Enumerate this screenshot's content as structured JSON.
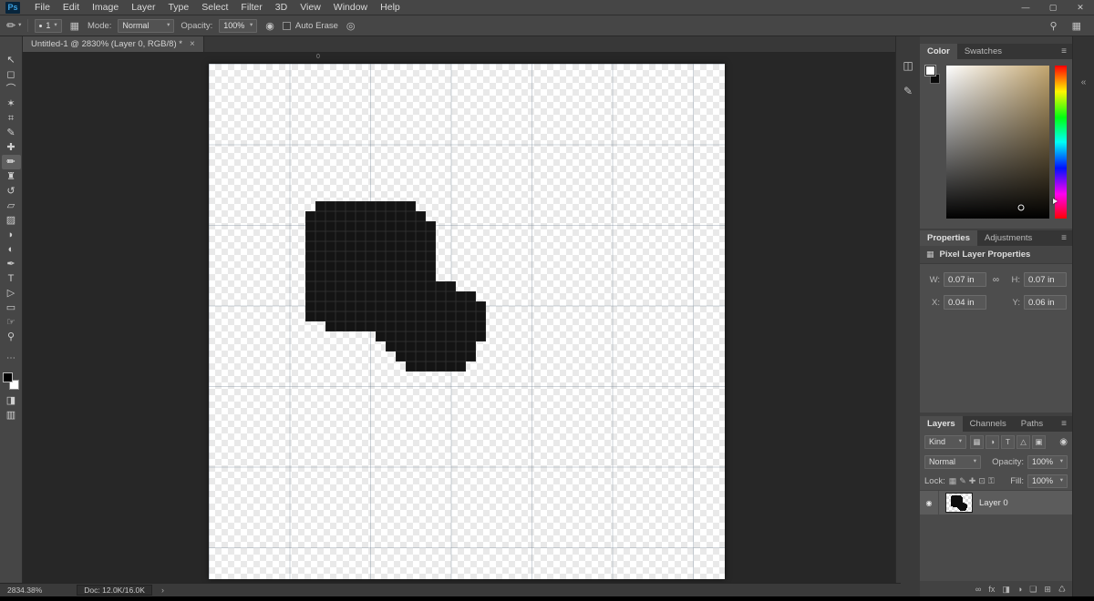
{
  "app": {
    "logo": "Ps"
  },
  "ui": {
    "caret": "▾"
  },
  "menu": {
    "items": [
      "File",
      "Edit",
      "Image",
      "Layer",
      "Type",
      "Select",
      "Filter",
      "3D",
      "View",
      "Window",
      "Help"
    ]
  },
  "window_controls": {
    "minimize": "—",
    "maximize": "▢",
    "close": "✕"
  },
  "options_bar": {
    "tool_preview_glyph": "✏",
    "brush_size": "1",
    "brush_panel_toggle_glyph": "▦",
    "mode_label": "Mode:",
    "mode_value": "Normal",
    "opacity_label": "Opacity:",
    "opacity_value": "100%",
    "pressure_glyph": "◉",
    "auto_erase_label": "Auto Erase",
    "smoothing_glyph": "◎",
    "search_glyph": "⚲",
    "workspace_glyph": "▦"
  },
  "document_tab": {
    "title": "Untitled-1 @ 2830% (Layer 0, RGB/8) *",
    "close_glyph": "×"
  },
  "tools": [
    {
      "name": "move",
      "glyph": "↖"
    },
    {
      "name": "rectangular-marquee",
      "glyph": "◻"
    },
    {
      "name": "lasso",
      "glyph": "⌒"
    },
    {
      "name": "quick-selection",
      "glyph": "✶"
    },
    {
      "name": "crop",
      "glyph": "⌗"
    },
    {
      "name": "eyedropper",
      "glyph": "✎"
    },
    {
      "name": "spot-healing-brush",
      "glyph": "✚"
    },
    {
      "name": "pencil",
      "glyph": "✏",
      "selected": true
    },
    {
      "name": "clone-stamp",
      "glyph": "♜"
    },
    {
      "name": "history-brush",
      "glyph": "↺"
    },
    {
      "name": "eraser",
      "glyph": "▱"
    },
    {
      "name": "gradient",
      "glyph": "▨"
    },
    {
      "name": "blur",
      "glyph": "◗"
    },
    {
      "name": "dodge",
      "glyph": "◐"
    },
    {
      "name": "pen",
      "glyph": "✒"
    },
    {
      "name": "type",
      "glyph": "T"
    },
    {
      "name": "path-selection",
      "glyph": "▷"
    },
    {
      "name": "rectangle",
      "glyph": "▭"
    },
    {
      "name": "hand",
      "glyph": "☞"
    },
    {
      "name": "zoom",
      "glyph": "⚲"
    }
  ],
  "tools_extra": {
    "more_glyph": "⋯",
    "mask_glyph": "◨",
    "screen_glyph": "▥"
  },
  "icon_strip": [
    {
      "name": "collapsed-panel-top",
      "glyph": "◫"
    },
    {
      "name": "collapsed-panel-bottom",
      "glyph": "✎"
    }
  ],
  "dock_edge": {
    "collapse_glyph": "«"
  },
  "color_panel": {
    "tabs": [
      "Color",
      "Swatches"
    ],
    "menu_glyph": "≡"
  },
  "properties_panel": {
    "tabs": [
      "Properties",
      "Adjustments"
    ],
    "menu_glyph": "≡",
    "header_icon": "▦",
    "title": "Pixel Layer Properties",
    "link_glyph": "∞",
    "fields": {
      "w_label": "W:",
      "w_value": "0.07 in",
      "h_label": "H:",
      "h_value": "0.07 in",
      "x_label": "X:",
      "x_value": "0.04 in",
      "y_label": "Y:",
      "y_value": "0.06 in"
    }
  },
  "layers_panel": {
    "tabs": [
      "Layers",
      "Channels",
      "Paths"
    ],
    "menu_glyph": "≡",
    "kind_label": "Kind",
    "filter_icons": [
      {
        "name": "filter-pixel-layers",
        "glyph": "▦"
      },
      {
        "name": "filter-adjustment-layers",
        "glyph": "◑"
      },
      {
        "name": "filter-type-layers",
        "glyph": "T"
      },
      {
        "name": "filter-shape-layers",
        "glyph": "△"
      },
      {
        "name": "filter-smart-objects",
        "glyph": "▣"
      }
    ],
    "filter_toggle_glyph": "◉",
    "blend_mode": "Normal",
    "opacity_label": "Opacity:",
    "opacity_value": "100%",
    "lock_label": "Lock:",
    "lock_icons": [
      {
        "name": "lock-transparency",
        "glyph": "▦"
      },
      {
        "name": "lock-paint",
        "glyph": "✎"
      },
      {
        "name": "lock-position",
        "glyph": "✚"
      },
      {
        "name": "lock-artboard",
        "glyph": "⊡"
      },
      {
        "name": "lock-all",
        "glyph": "⚿"
      }
    ],
    "fill_label": "Fill:",
    "fill_value": "100%",
    "eye_glyph": "◉",
    "rows": [
      {
        "name": "Layer 0",
        "visible": true
      }
    ],
    "bottom_icons": [
      {
        "name": "link-layers",
        "glyph": "∞"
      },
      {
        "name": "layer-effects",
        "glyph": "fx"
      },
      {
        "name": "add-layer-mask",
        "glyph": "◨"
      },
      {
        "name": "new-adjustment-layer",
        "glyph": "◑"
      },
      {
        "name": "new-group",
        "glyph": "❏"
      },
      {
        "name": "new-layer",
        "glyph": "⊞"
      },
      {
        "name": "delete-layer",
        "glyph": "♺"
      }
    ]
  },
  "status_bar": {
    "zoom": "2834.38%",
    "doc": "Doc: 12.0K/16.0K",
    "chevron": "›"
  },
  "canvas": {
    "ruler_label": "0",
    "pixel_size": 11,
    "blob_rows": [
      ".XXXXXXXXXX.......",
      "XXXXXXXXXXXX......",
      "XXXXXXXXXXXXX.....",
      "XXXXXXXXXXXXX.....",
      "XXXXXXXXXXXXX.....",
      "XXXXXXXXXXXXX.....",
      "XXXXXXXXXXXXX.....",
      "XXXXXXXXXXXXX.....",
      "XXXXXXXXXXXXXXX...",
      "XXXXXXXXXXXXXXXXX.",
      "XXXXXXXXXXXXXXXXXX",
      "XXXXXXXXXXXXXXXXXX",
      "..XXXXXXXXXXXXXXXX",
      ".......XXXXXXXXXXX",
      "........XXXXXXXXX.",
      ".........XXXXXXXX.",
      "..........XXXXXX.."
    ]
  },
  "colors": {
    "logo_blue": "#31a8ff",
    "blob": "#141414",
    "checker_light": "#e9e9e9",
    "panel_bg": "#4d4d4d",
    "app_bg": "#464646",
    "canvas_surround": "#272727"
  }
}
